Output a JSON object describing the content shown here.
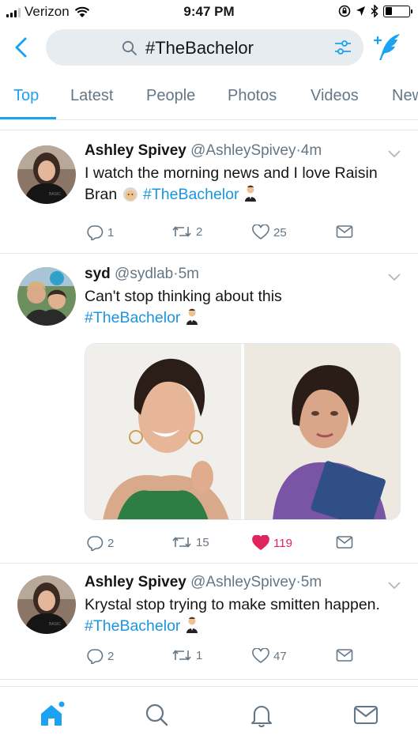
{
  "status_bar": {
    "carrier": "Verizon",
    "time": "9:47 PM"
  },
  "search": {
    "query": "#TheBachelor"
  },
  "tabs": [
    {
      "label": "Top",
      "active": true
    },
    {
      "label": "Latest",
      "active": false
    },
    {
      "label": "People",
      "active": false
    },
    {
      "label": "Photos",
      "active": false
    },
    {
      "label": "Videos",
      "active": false
    },
    {
      "label": "News",
      "active": false
    }
  ],
  "tweets": [
    {
      "name": "Ashley Spivey",
      "handle": "@AshleySpivey",
      "dot": "·",
      "time": "4m",
      "text_before": "I watch the morning news and I love Raisin Bran",
      "hashtag": "#TheBachelor",
      "replies": "1",
      "retweets": "2",
      "likes": "25",
      "liked": false
    },
    {
      "name": "syd",
      "handle": "@sydlab",
      "dot": "·",
      "time": "5m",
      "text_before": "Can't stop thinking about this",
      "hashtag": "#TheBachelor",
      "replies": "2",
      "retweets": "15",
      "likes": "119",
      "liked": true
    },
    {
      "name": "Ashley Spivey",
      "handle": "@AshleySpivey",
      "dot": "·",
      "time": "5m",
      "text_before": "Krystal stop trying to make smitten happen.",
      "hashtag": "#TheBachelor",
      "replies": "2",
      "retweets": "1",
      "likes": "47",
      "liked": false
    }
  ],
  "colors": {
    "accent": "#1da1f2",
    "hashtag": "#1b95e0",
    "like_active": "#e0245e",
    "secondary_text": "#657786",
    "divider": "#e1e8ed"
  },
  "icons": [
    "back-chevron-icon",
    "search-icon",
    "filter-sliders-icon",
    "compose-tweet-icon",
    "reply-icon",
    "retweet-icon",
    "heart-icon",
    "direct-message-icon",
    "home-icon",
    "notifications-bell-icon",
    "messages-envelope-icon"
  ]
}
